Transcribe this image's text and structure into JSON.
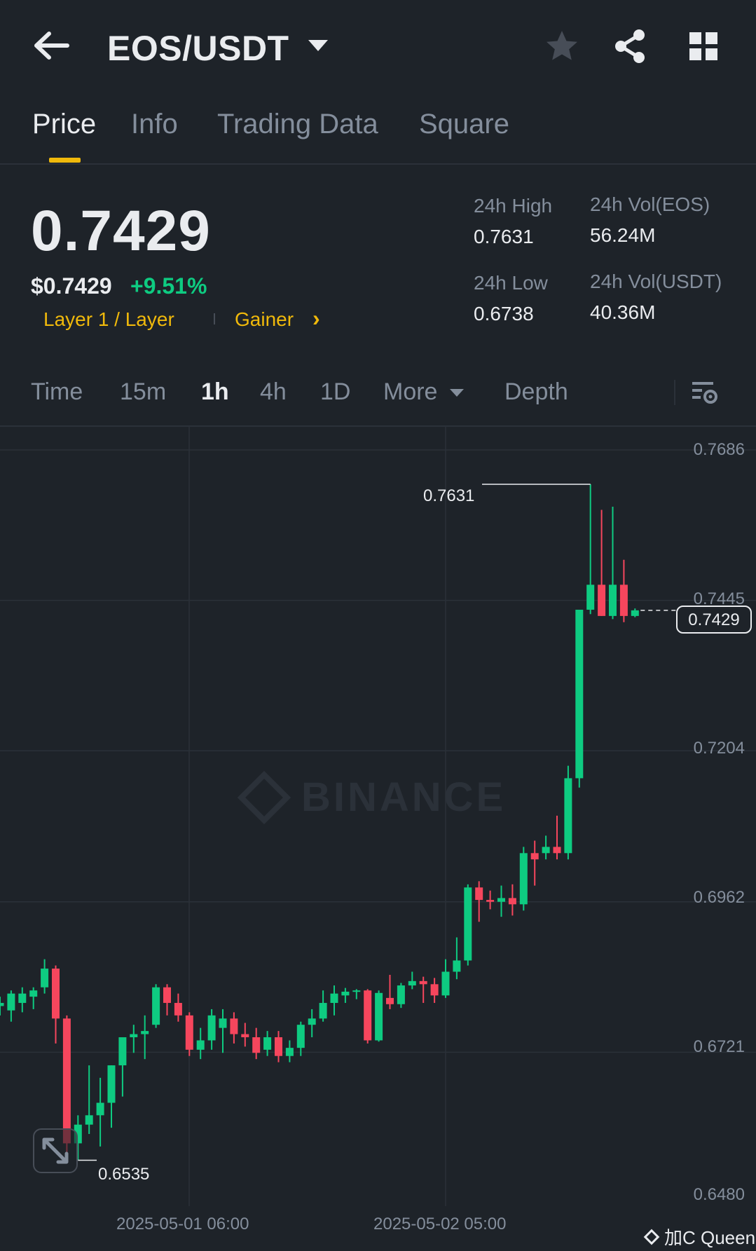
{
  "header": {
    "pair": "EOS/USDT",
    "icons": [
      "back-arrow-icon",
      "caret-down-icon",
      "star-icon",
      "share-icon",
      "grid-icon"
    ]
  },
  "tabs": [
    {
      "label": "Price",
      "active": true
    },
    {
      "label": "Info",
      "active": false
    },
    {
      "label": "Trading Data",
      "active": false
    },
    {
      "label": "Square",
      "active": false
    }
  ],
  "price": {
    "last": "0.7429",
    "usd": "$0.7429",
    "change": "+9.51%",
    "tag1": "Layer 1 / Layer",
    "tag2": "Gainer",
    "tag_arrow": "›"
  },
  "stats": {
    "high_label": "24h High",
    "high": "0.7631",
    "low_label": "24h Low",
    "low": "0.6738",
    "vol_base_label": "24h Vol(EOS)",
    "vol_base": "56.24M",
    "vol_quote_label": "24h Vol(USDT)",
    "vol_quote": "40.36M"
  },
  "intervals": {
    "time": "Time",
    "m15": "15m",
    "h1": "1h",
    "h4": "4h",
    "d1": "1D",
    "more": "More",
    "depth": "Depth",
    "active": "1h"
  },
  "colors": {
    "up": "#0ecb81",
    "down": "#f6465d",
    "accent": "#f0b90b",
    "bg": "#1e2329",
    "grid": "#2b3139",
    "muted": "#848e9c"
  },
  "watermark": "BINANCE",
  "footer_mark": "加C Queen",
  "chart_data": {
    "type": "candlestick",
    "y_ticks": [
      "0.7686",
      "0.7445",
      "0.7204",
      "0.6962",
      "0.6721",
      "0.6480"
    ],
    "ylim": [
      0.648,
      0.7686
    ],
    "x_ticks": [
      "2025-05-01 06:00",
      "2025-05-02 05:00"
    ],
    "high_marker": "0.7631",
    "low_marker": "0.6535",
    "last_price_label": "0.7429",
    "last_price": 0.7429,
    "candles": [
      {
        "o": 0.6795,
        "h": 0.681,
        "l": 0.678,
        "c": 0.68
      },
      {
        "o": 0.6788,
        "h": 0.682,
        "l": 0.677,
        "c": 0.6815
      },
      {
        "o": 0.68,
        "h": 0.6825,
        "l": 0.6785,
        "c": 0.6815
      },
      {
        "o": 0.681,
        "h": 0.6825,
        "l": 0.679,
        "c": 0.682
      },
      {
        "o": 0.6825,
        "h": 0.687,
        "l": 0.6815,
        "c": 0.6855
      },
      {
        "o": 0.6855,
        "h": 0.686,
        "l": 0.6735,
        "c": 0.6775
      },
      {
        "o": 0.6775,
        "h": 0.678,
        "l": 0.655,
        "c": 0.6575
      },
      {
        "o": 0.6575,
        "h": 0.662,
        "l": 0.6548,
        "c": 0.6605
      },
      {
        "o": 0.6605,
        "h": 0.67,
        "l": 0.659,
        "c": 0.662
      },
      {
        "o": 0.662,
        "h": 0.668,
        "l": 0.657,
        "c": 0.664
      },
      {
        "o": 0.664,
        "h": 0.67,
        "l": 0.66,
        "c": 0.67
      },
      {
        "o": 0.67,
        "h": 0.6745,
        "l": 0.665,
        "c": 0.6745
      },
      {
        "o": 0.6745,
        "h": 0.6765,
        "l": 0.672,
        "c": 0.675
      },
      {
        "o": 0.675,
        "h": 0.678,
        "l": 0.671,
        "c": 0.6755
      },
      {
        "o": 0.6765,
        "h": 0.683,
        "l": 0.676,
        "c": 0.6825
      },
      {
        "o": 0.6825,
        "h": 0.683,
        "l": 0.678,
        "c": 0.68
      },
      {
        "o": 0.68,
        "h": 0.6815,
        "l": 0.677,
        "c": 0.678
      },
      {
        "o": 0.678,
        "h": 0.6785,
        "l": 0.6715,
        "c": 0.6725
      },
      {
        "o": 0.6725,
        "h": 0.676,
        "l": 0.671,
        "c": 0.674
      },
      {
        "o": 0.674,
        "h": 0.679,
        "l": 0.6725,
        "c": 0.678
      },
      {
        "o": 0.676,
        "h": 0.679,
        "l": 0.672,
        "c": 0.6775
      },
      {
        "o": 0.6775,
        "h": 0.6785,
        "l": 0.6735,
        "c": 0.675
      },
      {
        "o": 0.675,
        "h": 0.6768,
        "l": 0.673,
        "c": 0.6745
      },
      {
        "o": 0.6745,
        "h": 0.676,
        "l": 0.671,
        "c": 0.672
      },
      {
        "o": 0.6725,
        "h": 0.6755,
        "l": 0.6715,
        "c": 0.6745
      },
      {
        "o": 0.6745,
        "h": 0.6755,
        "l": 0.6705,
        "c": 0.6715
      },
      {
        "o": 0.6715,
        "h": 0.674,
        "l": 0.6705,
        "c": 0.6728
      },
      {
        "o": 0.6728,
        "h": 0.677,
        "l": 0.6715,
        "c": 0.6765
      },
      {
        "o": 0.6765,
        "h": 0.679,
        "l": 0.6745,
        "c": 0.6775
      },
      {
        "o": 0.6775,
        "h": 0.682,
        "l": 0.677,
        "c": 0.68
      },
      {
        "o": 0.68,
        "h": 0.6828,
        "l": 0.678,
        "c": 0.6815
      },
      {
        "o": 0.6812,
        "h": 0.6824,
        "l": 0.68,
        "c": 0.6818
      },
      {
        "o": 0.6818,
        "h": 0.6822,
        "l": 0.6806,
        "c": 0.682
      },
      {
        "o": 0.682,
        "h": 0.6822,
        "l": 0.6735,
        "c": 0.674
      },
      {
        "o": 0.674,
        "h": 0.682,
        "l": 0.6738,
        "c": 0.6816
      },
      {
        "o": 0.6808,
        "h": 0.6845,
        "l": 0.679,
        "c": 0.6798
      },
      {
        "o": 0.6798,
        "h": 0.6832,
        "l": 0.6792,
        "c": 0.6828
      },
      {
        "o": 0.6828,
        "h": 0.685,
        "l": 0.6822,
        "c": 0.6835
      },
      {
        "o": 0.6835,
        "h": 0.6842,
        "l": 0.68,
        "c": 0.683
      },
      {
        "o": 0.683,
        "h": 0.684,
        "l": 0.68,
        "c": 0.6812
      },
      {
        "o": 0.6812,
        "h": 0.687,
        "l": 0.6808,
        "c": 0.685
      },
      {
        "o": 0.685,
        "h": 0.6905,
        "l": 0.6838,
        "c": 0.6868
      },
      {
        "o": 0.6868,
        "h": 0.699,
        "l": 0.686,
        "c": 0.6985
      },
      {
        "o": 0.6985,
        "h": 0.6995,
        "l": 0.693,
        "c": 0.6965
      },
      {
        "o": 0.6965,
        "h": 0.698,
        "l": 0.695,
        "c": 0.6962
      },
      {
        "o": 0.6962,
        "h": 0.6988,
        "l": 0.6938,
        "c": 0.6968
      },
      {
        "o": 0.6968,
        "h": 0.699,
        "l": 0.694,
        "c": 0.6958
      },
      {
        "o": 0.6958,
        "h": 0.705,
        "l": 0.6948,
        "c": 0.704
      },
      {
        "o": 0.704,
        "h": 0.706,
        "l": 0.6988,
        "c": 0.703
      },
      {
        "o": 0.704,
        "h": 0.7068,
        "l": 0.703,
        "c": 0.705
      },
      {
        "o": 0.705,
        "h": 0.71,
        "l": 0.703,
        "c": 0.704
      },
      {
        "o": 0.704,
        "h": 0.718,
        "l": 0.703,
        "c": 0.716
      },
      {
        "o": 0.716,
        "h": 0.742,
        "l": 0.7145,
        "c": 0.743
      },
      {
        "o": 0.743,
        "h": 0.7631,
        "l": 0.7423,
        "c": 0.747
      },
      {
        "o": 0.747,
        "h": 0.759,
        "l": 0.742,
        "c": 0.742
      },
      {
        "o": 0.742,
        "h": 0.7595,
        "l": 0.7415,
        "c": 0.747
      },
      {
        "o": 0.747,
        "h": 0.751,
        "l": 0.741,
        "c": 0.742
      },
      {
        "o": 0.742,
        "h": 0.7432,
        "l": 0.7418,
        "c": 0.7429
      }
    ]
  }
}
